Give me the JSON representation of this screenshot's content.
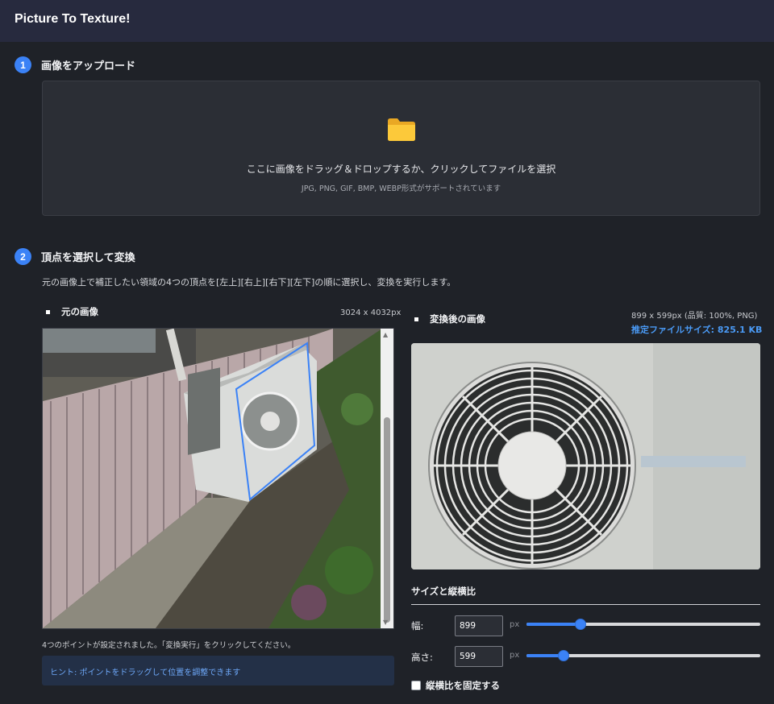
{
  "app": {
    "title": "Picture To Texture!"
  },
  "steps": [
    {
      "number": "1",
      "label": "画像をアップロード"
    },
    {
      "number": "2",
      "label": "頂点を選択して変換"
    }
  ],
  "upload": {
    "icon": "folder-icon",
    "main_text": "ここに画像をドラッグ＆ドロップするか、クリックしてファイルを選択",
    "sub_text": "JPG, PNG, GIF, BMP, WEBP形式がサポートされています"
  },
  "transform": {
    "description": "元の画像上で補正したい領域の4つの頂点を[左上][右上][右下][左下]の順に選択し、変換を実行します。"
  },
  "source": {
    "label": "元の画像",
    "dimensions": "3024 x 4032px",
    "status": "4つのポイントが設定されました。「変換実行」をクリックしてください。",
    "hint": "ヒント: ポイントをドラッグして位置を調整できます"
  },
  "result": {
    "label": "変換後の画像",
    "meta": "899 x 599px (品質: 100%, PNG)",
    "filesize": "推定ファイルサイズ: 825.1 KB"
  },
  "size_controls": {
    "title": "サイズと縦横比",
    "width_label": "幅:",
    "width_value": "899",
    "height_label": "高さ:",
    "height_value": "599",
    "unit": "px",
    "width_slider_fraction": 0.23,
    "height_slider_fraction": 0.16,
    "lock_ratio_label": "縦横比を固定する",
    "lock_ratio_checked": false
  },
  "colors": {
    "accent": "#3b82f6",
    "header_bg": "#272a3e",
    "page_bg": "#1f2228",
    "hint_text": "#6da7f7"
  }
}
